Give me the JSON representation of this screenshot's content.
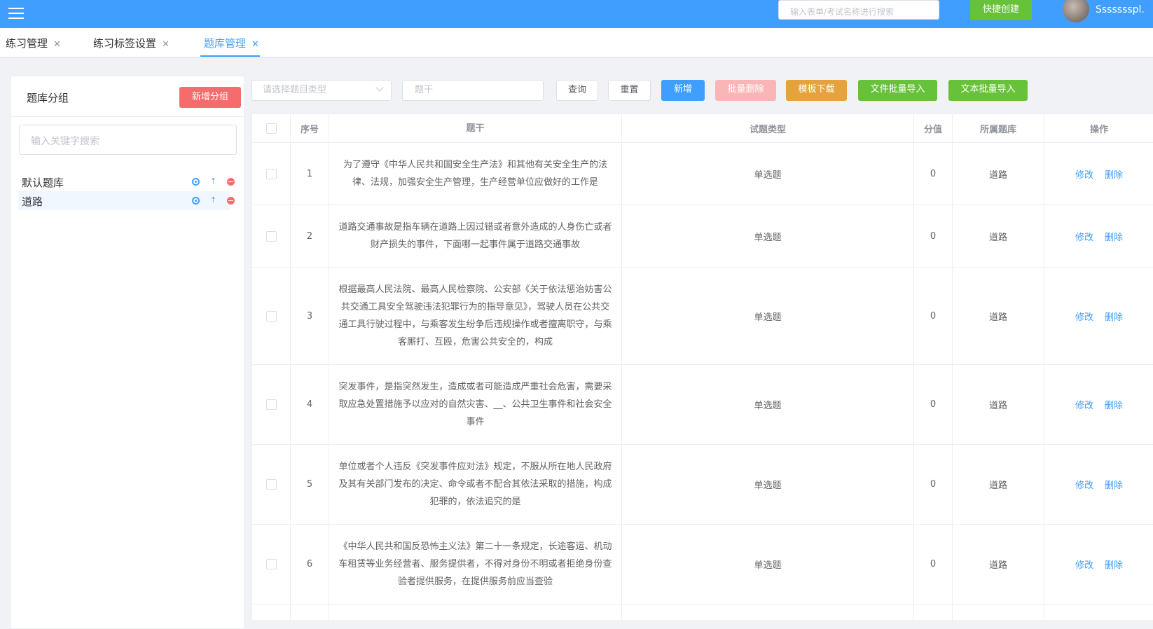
{
  "header": {
    "search_placeholder": "输入表单/考试名称进行搜索",
    "quick_create": "快捷创建",
    "username": "Ssssssspl."
  },
  "tabs": [
    {
      "label": "练习管理",
      "close": "✕"
    },
    {
      "label": "练习标签设置",
      "close": "✕"
    },
    {
      "label": "题库管理",
      "close": "✕"
    }
  ],
  "left": {
    "title": "题库分组",
    "add_label": "新增分组",
    "search_placeholder": "输入关键字搜索",
    "groups": [
      {
        "name": "默认题库"
      },
      {
        "name": "道路"
      }
    ]
  },
  "toolbar": {
    "type_placeholder": "请选择题目类型",
    "stem_placeholder": "题干",
    "query": "查询",
    "reset": "重置",
    "add": "新增",
    "batch_delete": "批量删除",
    "template_download": "模板下载",
    "file_import": "文件批量导入",
    "text_import": "文本批量导入"
  },
  "table": {
    "headers": {
      "no": "序号",
      "stem": "题干",
      "type": "试题类型",
      "score": "分值",
      "bank": "所属题库",
      "ops": "操作"
    },
    "edit_label": "修改",
    "delete_label": "删除",
    "rows": [
      {
        "no": "1",
        "stem": "为了遵守《中华人民共和国安全生产法》和其他有关安全生产的法律、法规，加强安全生产管理，生产经营单位应做好的工作是",
        "type": "单选题",
        "score": "0",
        "bank": "道路"
      },
      {
        "no": "2",
        "stem": "道路交通事故是指车辆在道路上因过错或者意外造成的人身伤亡或者财产损失的事件，下面哪一起事件属于道路交通事故",
        "type": "单选题",
        "score": "0",
        "bank": "道路"
      },
      {
        "no": "3",
        "stem": "根据最高人民法院、最高人民检察院、公安部《关于依法惩治妨害公共交通工具安全驾驶违法犯罪行为的指导意见》，驾驶人员在公共交通工具行驶过程中，与乘客发生纷争后违规操作或者擅离职守，与乘客厮打、互殴，危害公共安全的，构成",
        "type": "单选题",
        "score": "0",
        "bank": "道路"
      },
      {
        "no": "4",
        "stem": "突发事件，是指突然发生，造成或者可能造成严重社会危害，需要采取应急处置措施予以应对的自然灾害、__、公共卫生事件和社会安全事件",
        "type": "单选题",
        "score": "0",
        "bank": "道路"
      },
      {
        "no": "5",
        "stem": "单位或者个人违反《突发事件应对法》规定，不服从所在地人民政府及其有关部门发布的决定、命令或者不配合其依法采取的措施，构成犯罪的，依法追究的是",
        "type": "单选题",
        "score": "0",
        "bank": "道路"
      },
      {
        "no": "6",
        "stem": "《中华人民共和国反恐怖主义法》第二十一条规定，长途客运、机动车租赁等业务经营者、服务提供者，不得对身份不明或者拒绝身份查验者提供服务，在提供服务前应当查验",
        "type": "单选题",
        "score": "0",
        "bank": "道路"
      }
    ]
  }
}
